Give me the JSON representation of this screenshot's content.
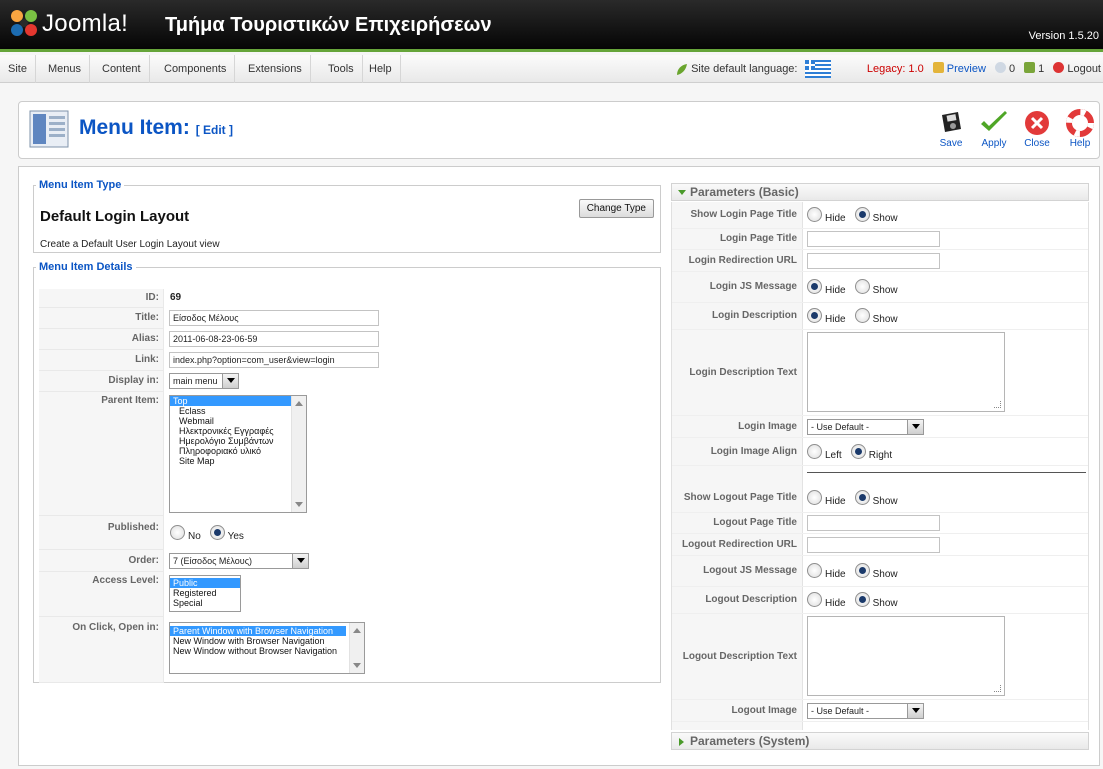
{
  "header": {
    "logo_text": "Joomla!",
    "site_title": "Τμήμα Τουριστικών Επιχειρήσεων",
    "version": "Version 1.5.20"
  },
  "menu": {
    "items": [
      "Site",
      "Menus",
      "Content",
      "Components",
      "Extensions",
      "Tools",
      "Help"
    ]
  },
  "status": {
    "language_label": "Site default language:",
    "legacy": "Legacy: 1.0",
    "preview": "Preview",
    "messages_count": "0",
    "users_count": "1",
    "logout": "Logout"
  },
  "toolbar": {
    "title": "Menu Item:",
    "subtitle": "[ Edit ]",
    "save": "Save",
    "apply": "Apply",
    "close": "Close",
    "help": "Help"
  },
  "item_type": {
    "legend": "Menu Item Type",
    "name": "Default Login Layout",
    "description": "Create a Default User Login Layout view",
    "change_button": "Change Type"
  },
  "details": {
    "legend": "Menu Item Details",
    "id_label": "ID:",
    "id_value": "69",
    "title_label": "Title:",
    "title_value": "Είσοδος Μέλους",
    "alias_label": "Alias:",
    "alias_value": "2011-06-08-23-06-59",
    "link_label": "Link:",
    "link_value": "index.php?option=com_user&view=login",
    "display_label": "Display in:",
    "display_value": "main menu",
    "parent_label": "Parent Item:",
    "parent_options": [
      "Top",
      "Eclass",
      "Webmail",
      "Ηλεκτρονικές Εγγραφές",
      "Ημερολόγιο Συμβάντων",
      "Πληροφοριακό υλικό",
      "Site Map"
    ],
    "published_label": "Published:",
    "published_no": "No",
    "published_yes": "Yes",
    "order_label": "Order:",
    "order_value": "7 (Είσοδος Μέλους)",
    "access_label": "Access Level:",
    "access_options": [
      "Public",
      "Registered",
      "Special"
    ],
    "onclick_label": "On Click, Open in:",
    "onclick_options": [
      "Parent Window with Browser Navigation",
      "New Window with Browser Navigation",
      "New Window without Browser Navigation"
    ]
  },
  "params_basic": {
    "header": "Parameters (Basic)",
    "hide": "Hide",
    "show": "Show",
    "left": "Left",
    "right": "Right",
    "show_login_title": "Show Login Page Title",
    "login_title": "Login Page Title",
    "login_redirect": "Login Redirection URL",
    "login_js": "Login JS Message",
    "login_desc": "Login Description",
    "login_desc_text": "Login Description Text",
    "login_image": "Login Image",
    "login_image_value": "- Use Default -",
    "login_image_align": "Login Image Align",
    "show_logout_title": "Show Logout Page Title",
    "logout_title": "Logout Page Title",
    "logout_redirect": "Logout Redirection URL",
    "logout_js": "Logout JS Message",
    "logout_desc": "Logout Description",
    "logout_desc_text": "Logout Description Text",
    "logout_image": "Logout Image",
    "logout_image_value": "- Use Default -"
  },
  "params_system": {
    "header": "Parameters (System)"
  },
  "colors": {
    "accent_green": "#66a53a",
    "link_blue": "#0b55c4",
    "legacy_red": "#cc0000",
    "selection_blue": "#3399ff"
  }
}
